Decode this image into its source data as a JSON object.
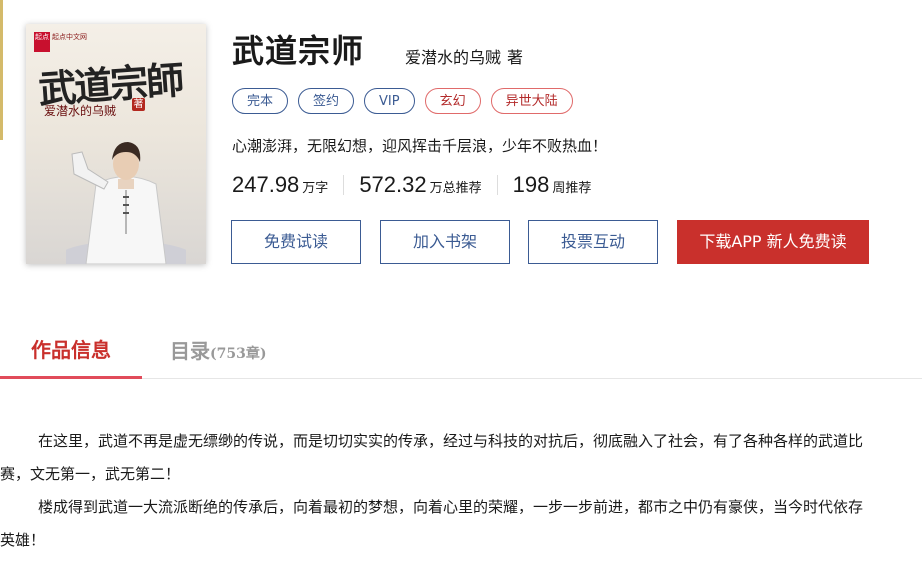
{
  "book": {
    "title": "武道宗师",
    "author": "爱潜水的乌贼",
    "author_mark": "著",
    "cover": {
      "title_art": "武道宗師",
      "author": "爱潜水的乌贼",
      "author_mark": "著",
      "logo": "起点中文网",
      "publisher": "起点中文网"
    },
    "tags": [
      {
        "label": "完本",
        "color": "#3b5b93"
      },
      {
        "label": "签约",
        "color": "#3b5b93"
      },
      {
        "label": "VIP",
        "color": "#3b5b93"
      },
      {
        "label": "玄幻",
        "color": "#b32a2a"
      },
      {
        "label": "异世大陆",
        "color": "#b32a2a"
      }
    ],
    "intro": "心潮澎湃，无限幻想，迎风挥击千层浪，少年不败热血！",
    "stats": [
      {
        "value": "247.98",
        "unit": "万字"
      },
      {
        "value": "572.32",
        "unit": "万总推荐"
      },
      {
        "value": "198",
        "unit": "周推荐"
      }
    ]
  },
  "actions": {
    "free_read": "免费试读",
    "add_shelf": "加入书架",
    "vote": "投票互动",
    "download": "下载APP  新人免费读"
  },
  "tabs": {
    "info": "作品信息",
    "toc": "目录",
    "toc_count": "(753章)"
  },
  "description": [
    "在这里，武道不再是虚无缥缈的传说，而是切切实实的传承，经过与科技的对抗后，彻底融入了社会，有了各种各样的武道比赛，文无第一，武无第二！",
    "楼成得到武道一大流派断绝的传承后，向着最初的梦想，向着心里的荣耀，一步一步前进，都市之中仍有豪侠，当今时代依存英雄！"
  ],
  "colors": {
    "accent_red": "#c9302c",
    "tab_underline": "#e14b5a",
    "button_blue": "#3b5b93"
  }
}
